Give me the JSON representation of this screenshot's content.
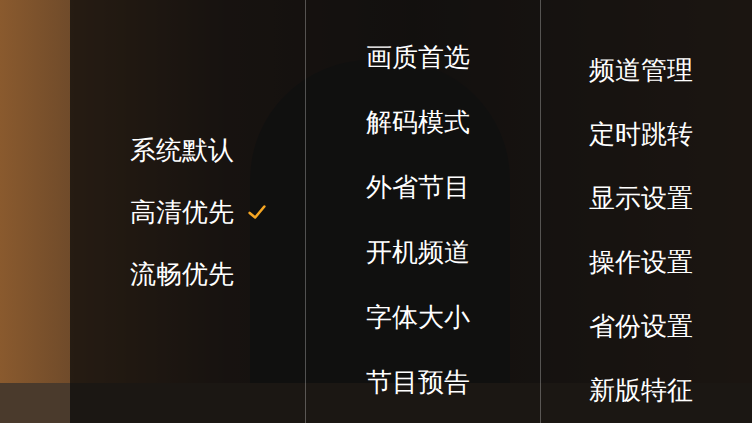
{
  "video": {
    "playing": true
  },
  "options": [
    {
      "label": "系统默认",
      "selected": false
    },
    {
      "label": "高清优先",
      "selected": true
    },
    {
      "label": "流畅优先",
      "selected": false
    }
  ],
  "categories": [
    {
      "label": "画质首选"
    },
    {
      "label": "解码模式"
    },
    {
      "label": "外省节目"
    },
    {
      "label": "开机频道"
    },
    {
      "label": "字体大小"
    },
    {
      "label": "节目预告"
    }
  ],
  "settings": [
    {
      "label": "频道管理"
    },
    {
      "label": "定时跳转"
    },
    {
      "label": "显示设置"
    },
    {
      "label": "操作设置"
    },
    {
      "label": "省份设置"
    },
    {
      "label": "新版特征"
    }
  ]
}
